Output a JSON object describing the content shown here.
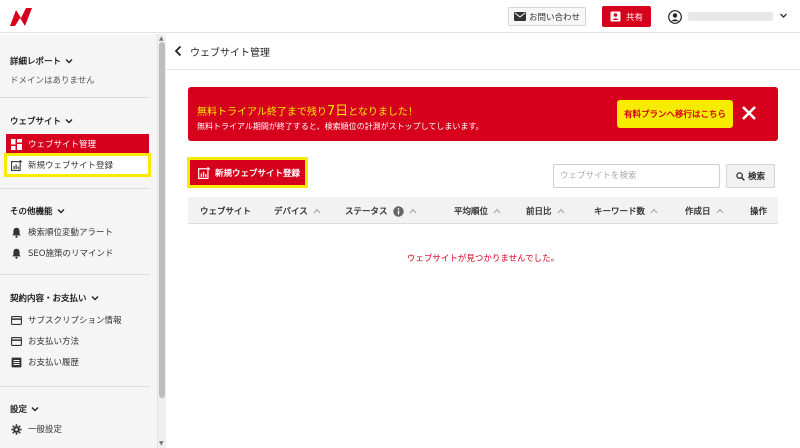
{
  "topbar": {
    "contact_label": "お問い合わせ",
    "share_label": "共有"
  },
  "sidebar": {
    "sections": {
      "report": {
        "title": "詳細レポート",
        "empty_text": "ドメインはありません"
      },
      "website": {
        "title": "ウェブサイト",
        "items": [
          {
            "label": "ウェブサイト管理",
            "icon": "dashboard-icon",
            "active": true
          },
          {
            "label": "新規ウェブサイト登録",
            "icon": "add-chart-icon",
            "highlighted": true
          }
        ]
      },
      "other": {
        "title": "その他機能",
        "items": [
          {
            "label": "検索順位変動アラート",
            "icon": "bell-icon"
          },
          {
            "label": "SEO施策のリマインド",
            "icon": "bell-icon"
          }
        ]
      },
      "billing": {
        "title": "契約内容・お支払い",
        "items": [
          {
            "label": "サブスクリプション情報",
            "icon": "card-icon"
          },
          {
            "label": "お支払い方法",
            "icon": "card-icon"
          },
          {
            "label": "お支払い履歴",
            "icon": "list-icon"
          }
        ]
      },
      "settings": {
        "title": "設定",
        "items": [
          {
            "label": "一般設定",
            "icon": "gear-icon"
          }
        ]
      }
    }
  },
  "main": {
    "title": "ウェブサイト管理",
    "banner": {
      "title_prefix": "無料トライアル終了まで残り",
      "days": "7日",
      "title_suffix": "となりました！",
      "subtitle": "無料トライアル期間が終了すると、検索順位の計測がストップしてしまいます。",
      "cta_label": "有料プランへ移行はこちら"
    },
    "new_site_label": "新規ウェブサイト登録",
    "search": {
      "placeholder": "ウェブサイトを検索",
      "value": "",
      "button_label": "検索"
    },
    "table": {
      "columns": [
        "ウェブサイト",
        "デバイス",
        "ステータス",
        "平均順位",
        "前日比",
        "キーワード数",
        "作成日",
        "操作"
      ],
      "empty_message": "ウェブサイトが見つかりませんでした。"
    }
  },
  "colors": {
    "brand_red": "#d6001c",
    "highlight_yellow": "#f7ec00"
  }
}
